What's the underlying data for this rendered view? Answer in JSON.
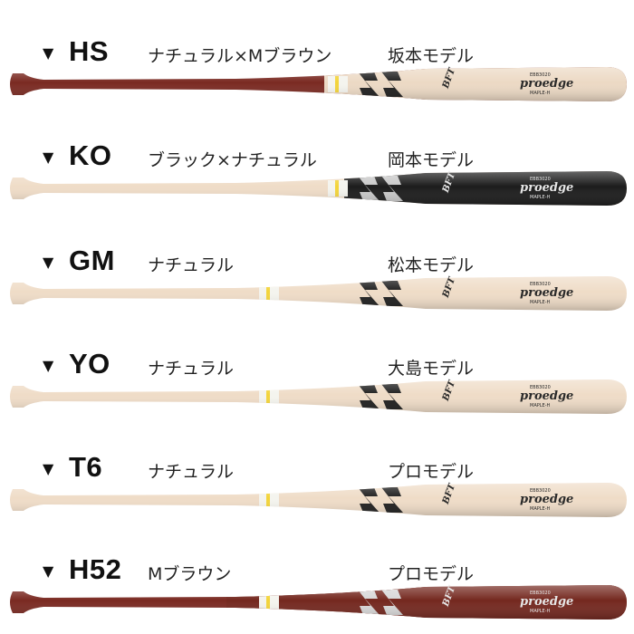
{
  "marker": "▼",
  "bats": [
    {
      "code": "HS",
      "color": "ナチュラル×Mブラウン",
      "model": "坂本モデル",
      "handle_color": "#7a2a22",
      "barrel_color": "#ecd9c4",
      "style": "hs",
      "brand": "proedge",
      "sub": "MAPLE-H",
      "serial": "EBB3020",
      "mark": "BFT"
    },
    {
      "code": "KO",
      "color": "ブラック×ナチュラル",
      "model": "岡本モデル",
      "handle_color": "#efdcc7",
      "barrel_color": "#1c1c1c",
      "style": "ko",
      "brand": "proedge",
      "sub": "MAPLE-H",
      "serial": "EBB3020",
      "mark": "BFT"
    },
    {
      "code": "GM",
      "color": "ナチュラル",
      "model": "松本モデル",
      "handle_color": "#efdcc7",
      "barrel_color": "#ecd9c4",
      "style": "nat",
      "brand": "proedge",
      "sub": "MAPLE-H",
      "serial": "EBB3020",
      "mark": "BFT"
    },
    {
      "code": "YO",
      "color": "ナチュラル",
      "model": "大島モデル",
      "handle_color": "#efdcc7",
      "barrel_color": "#ecd9c4",
      "style": "nat",
      "brand": "proedge",
      "sub": "MAPLE-H",
      "serial": "EBB3020",
      "mark": "BFT"
    },
    {
      "code": "T6",
      "color": "ナチュラル",
      "model": "プロモデル",
      "handle_color": "#efdcc7",
      "barrel_color": "#ecd9c4",
      "style": "nat",
      "brand": "proedge",
      "sub": "MAPLE-H",
      "serial": "EBB3020",
      "mark": "BFT"
    },
    {
      "code": "H52",
      "color": "Mブラウン",
      "model": "プロモデル",
      "handle_color": "#7a2a22",
      "barrel_color": "#74281f",
      "style": "brown",
      "brand": "proedge",
      "sub": "MAPLE-H",
      "serial": "EBB3020",
      "mark": "BFT"
    }
  ]
}
